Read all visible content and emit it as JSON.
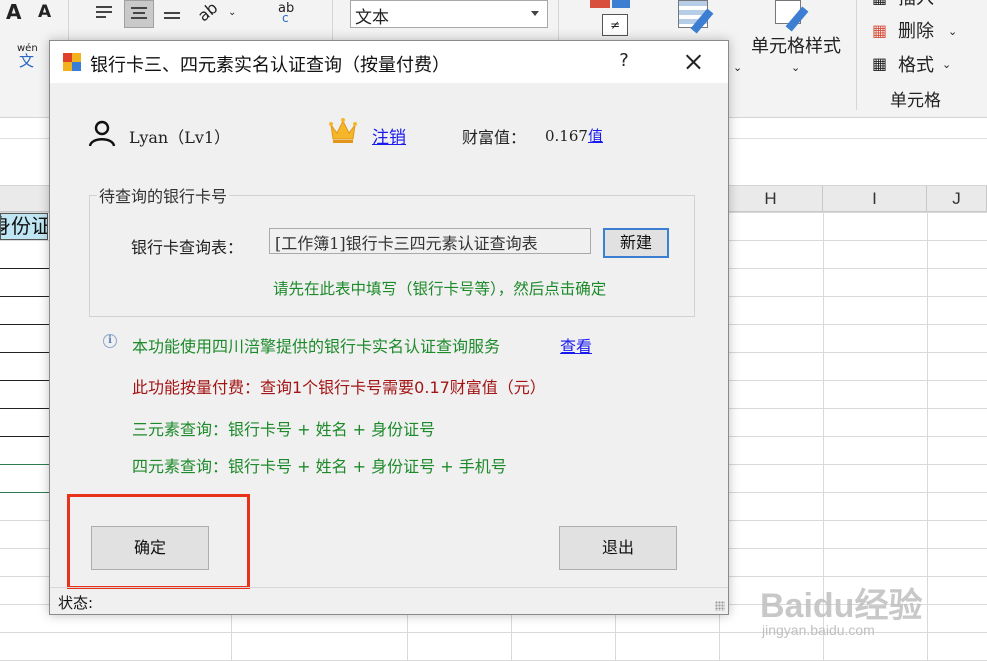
{
  "ribbon": {
    "font_grow_label": "A",
    "font_shrink_label": "A",
    "phonetic_top": "wén",
    "phonetic_bottom": "文",
    "orientation_label": "ab",
    "orientation_sub": "c",
    "number_format_value": "文本",
    "cell_styles_label": "单元格样式",
    "insert_label": "插入",
    "delete_label": "删除",
    "format_label": "格式",
    "cells_group_label": "单元格"
  },
  "sheet": {
    "columns": [
      "H",
      "I",
      "J"
    ],
    "cell_header_text": "身份证"
  },
  "dialog": {
    "title": "银行卡三、四元素实名认证查询（按量付费）",
    "help_label": "?",
    "user": {
      "name": "Lyan（Lv1）",
      "logout_label": "注销",
      "wealth_label": "财富值：",
      "wealth_value": "0.167",
      "wealth_value_tail": "值"
    },
    "query_group": {
      "legend": "待查询的银行卡号",
      "table_label": "银行卡查询表：",
      "table_value": "[工作簿1]银行卡三四元素认证查询表",
      "new_button": "新建",
      "hint": "请先在此表中填写（银行卡号等），然后点击确定"
    },
    "info": {
      "icon_glyph": "i",
      "service_text": "本功能使用四川涪擎提供的银行卡实名认证查询服务",
      "view_link": "查看",
      "fee_text": "此功能按量付费：查询1个银行卡号需要0.17财富值（元）",
      "three_elements": "三元素查询：银行卡号 + 姓名 + 身份证号",
      "four_elements": "四元素查询：银行卡号 + 姓名 + 身份证号 + 手机号"
    },
    "ok_button": "确定",
    "exit_button": "退出",
    "status_label": "状态:"
  },
  "watermark": {
    "main": "Baidu经验",
    "sub": "jingyan.baidu.com"
  },
  "colors": {
    "green_text": "#1d8a2a",
    "red_text": "#a31515",
    "link_blue": "#1a1aee",
    "highlight_red": "#e8321a",
    "cell_header_fill": "#bfe6f2"
  }
}
